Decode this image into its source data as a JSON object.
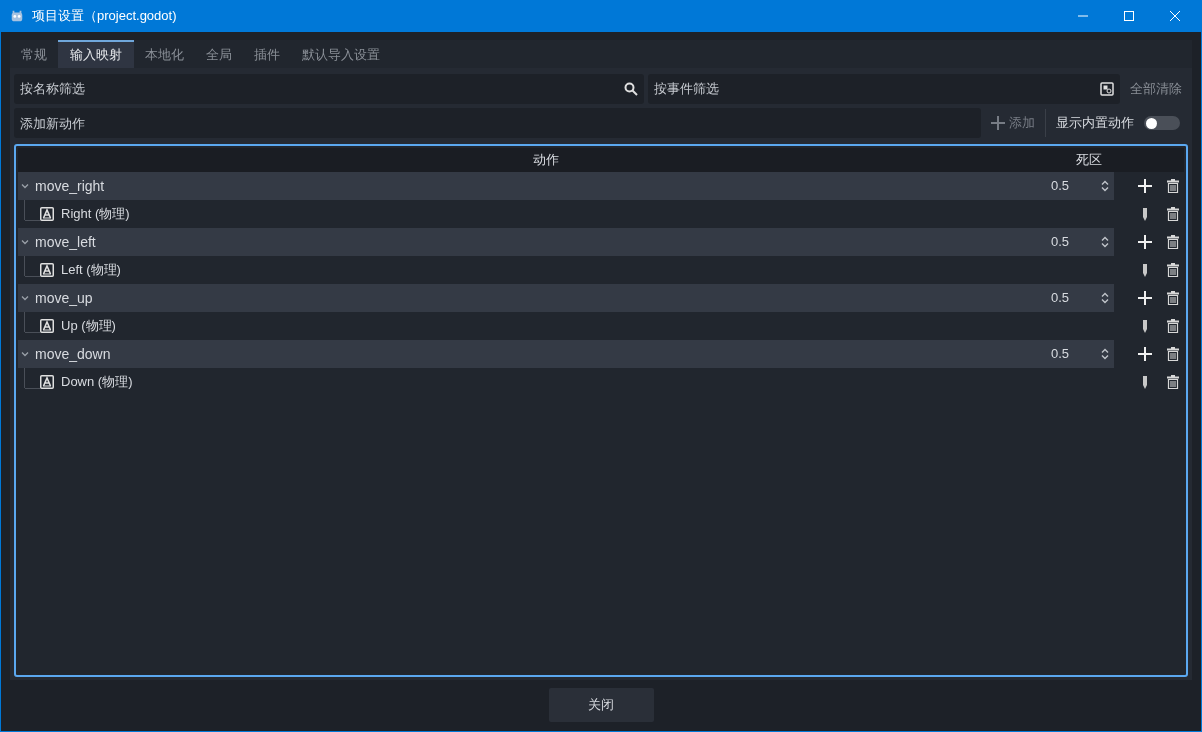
{
  "window": {
    "title": "项目设置（project.godot)"
  },
  "tabs": [
    {
      "label": "常规",
      "selected": false
    },
    {
      "label": "输入映射",
      "selected": true
    },
    {
      "label": "本地化",
      "selected": false
    },
    {
      "label": "全局",
      "selected": false
    },
    {
      "label": "插件",
      "selected": false
    },
    {
      "label": "默认导入设置",
      "selected": false
    }
  ],
  "name_filter": {
    "placeholder": "按名称筛选"
  },
  "event_filter": {
    "placeholder": "按事件筛选"
  },
  "clear_all_button": "全部清除",
  "new_action": {
    "placeholder": "添加新动作"
  },
  "add_button": "添加",
  "show_builtin": {
    "label": "显示内置动作",
    "on": false
  },
  "table": {
    "columns": [
      "动作",
      "死区"
    ],
    "actions": [
      {
        "name": "move_right",
        "expanded": true,
        "deadzone": "0.5",
        "events": [
          "Right (物理)"
        ]
      },
      {
        "name": "move_left",
        "expanded": true,
        "deadzone": "0.5",
        "events": [
          "Left (物理)"
        ]
      },
      {
        "name": "move_up",
        "expanded": true,
        "deadzone": "0.5",
        "events": [
          "Up (物理)"
        ]
      },
      {
        "name": "move_down",
        "expanded": true,
        "deadzone": "0.5",
        "events": [
          "Down (物理)"
        ]
      }
    ]
  },
  "close_button": "关闭"
}
